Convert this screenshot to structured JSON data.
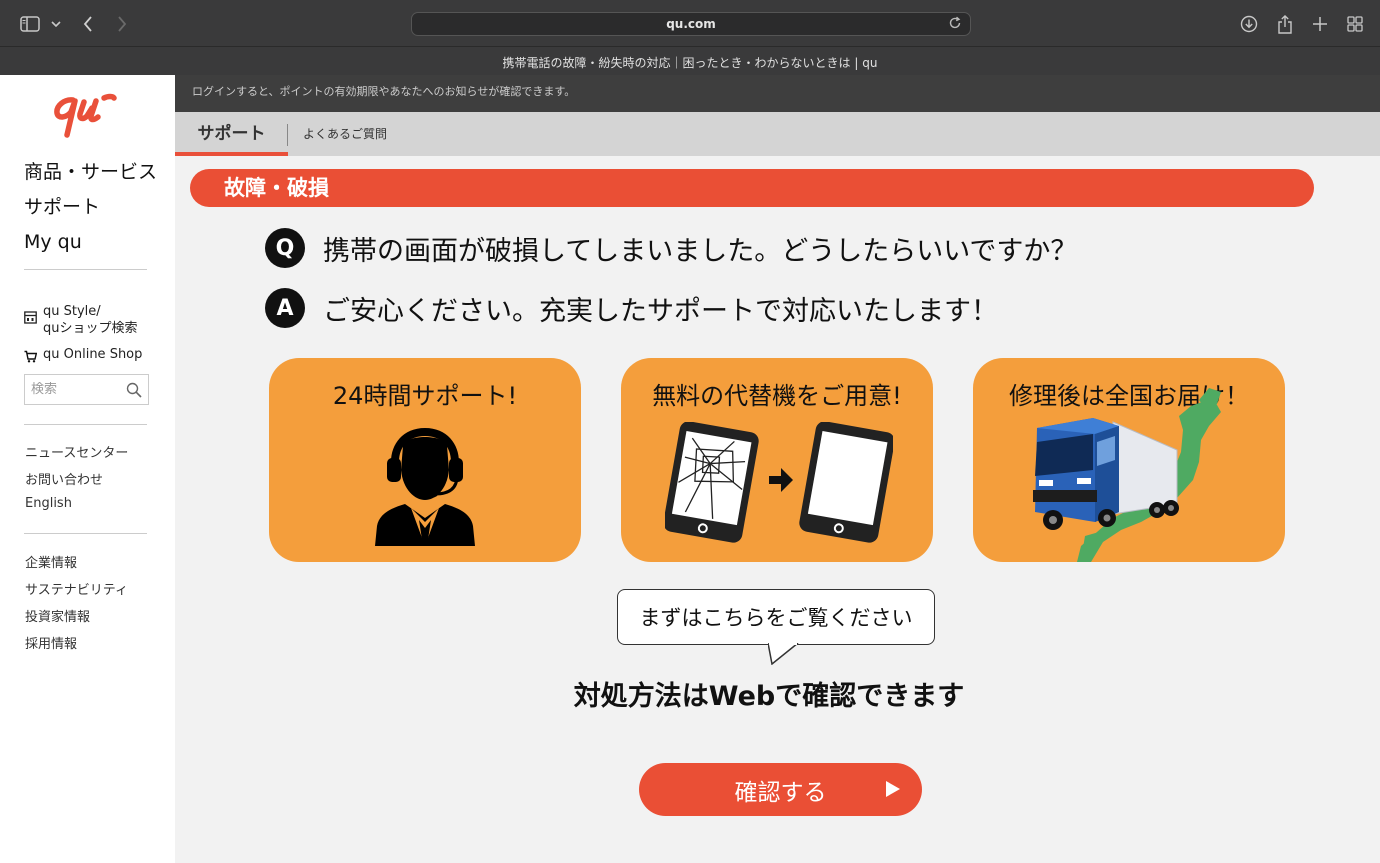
{
  "browser": {
    "url": "qu.com",
    "page_title": "携帯電話の故障・紛失時の対応｜困ったとき・わからないときは | qu"
  },
  "sidebar": {
    "logo_text": "qu",
    "main_nav": [
      "商品・サービス",
      "サポート",
      "My qu"
    ],
    "store_search_line1": "qu Style/",
    "store_search_line2": "quショップ検索",
    "online_shop": "qu Online Shop",
    "search_placeholder": "検索",
    "group1": [
      "ニュースセンター",
      "お問い合わせ",
      "English"
    ],
    "group2": [
      "企業情報",
      "サステナビリティ",
      "投資家情報",
      "採用情報"
    ]
  },
  "login_bar": "ログインすると、ポイントの有効期限やあなたへのお知らせが確認できます。",
  "tabs": {
    "support": "サポート",
    "faq": "よくあるご質問"
  },
  "section": {
    "title": "故障・破損",
    "q_badge": "Q",
    "question": "携帯の画面が破損してしまいました。どうしたらいいですか？",
    "a_badge": "A",
    "answer": "ご安心ください。充実したサポートで対応いたします！"
  },
  "cards": [
    {
      "title": "24時間サポート!",
      "icon": "operator-headset-icon"
    },
    {
      "title": "無料の代替機をご用意!",
      "icon": "phone-replacement-icon"
    },
    {
      "title": "修理後は全国お届け！",
      "icon": "delivery-truck-japan-icon"
    }
  ],
  "bubble": "まずはこちらをご覧ください",
  "heading": "対処方法はWebで確認できます",
  "cta_label": "確認する",
  "colors": {
    "accent": "#ea4f35",
    "card": "#f49e3c",
    "chrome": "#3a3a3b"
  }
}
